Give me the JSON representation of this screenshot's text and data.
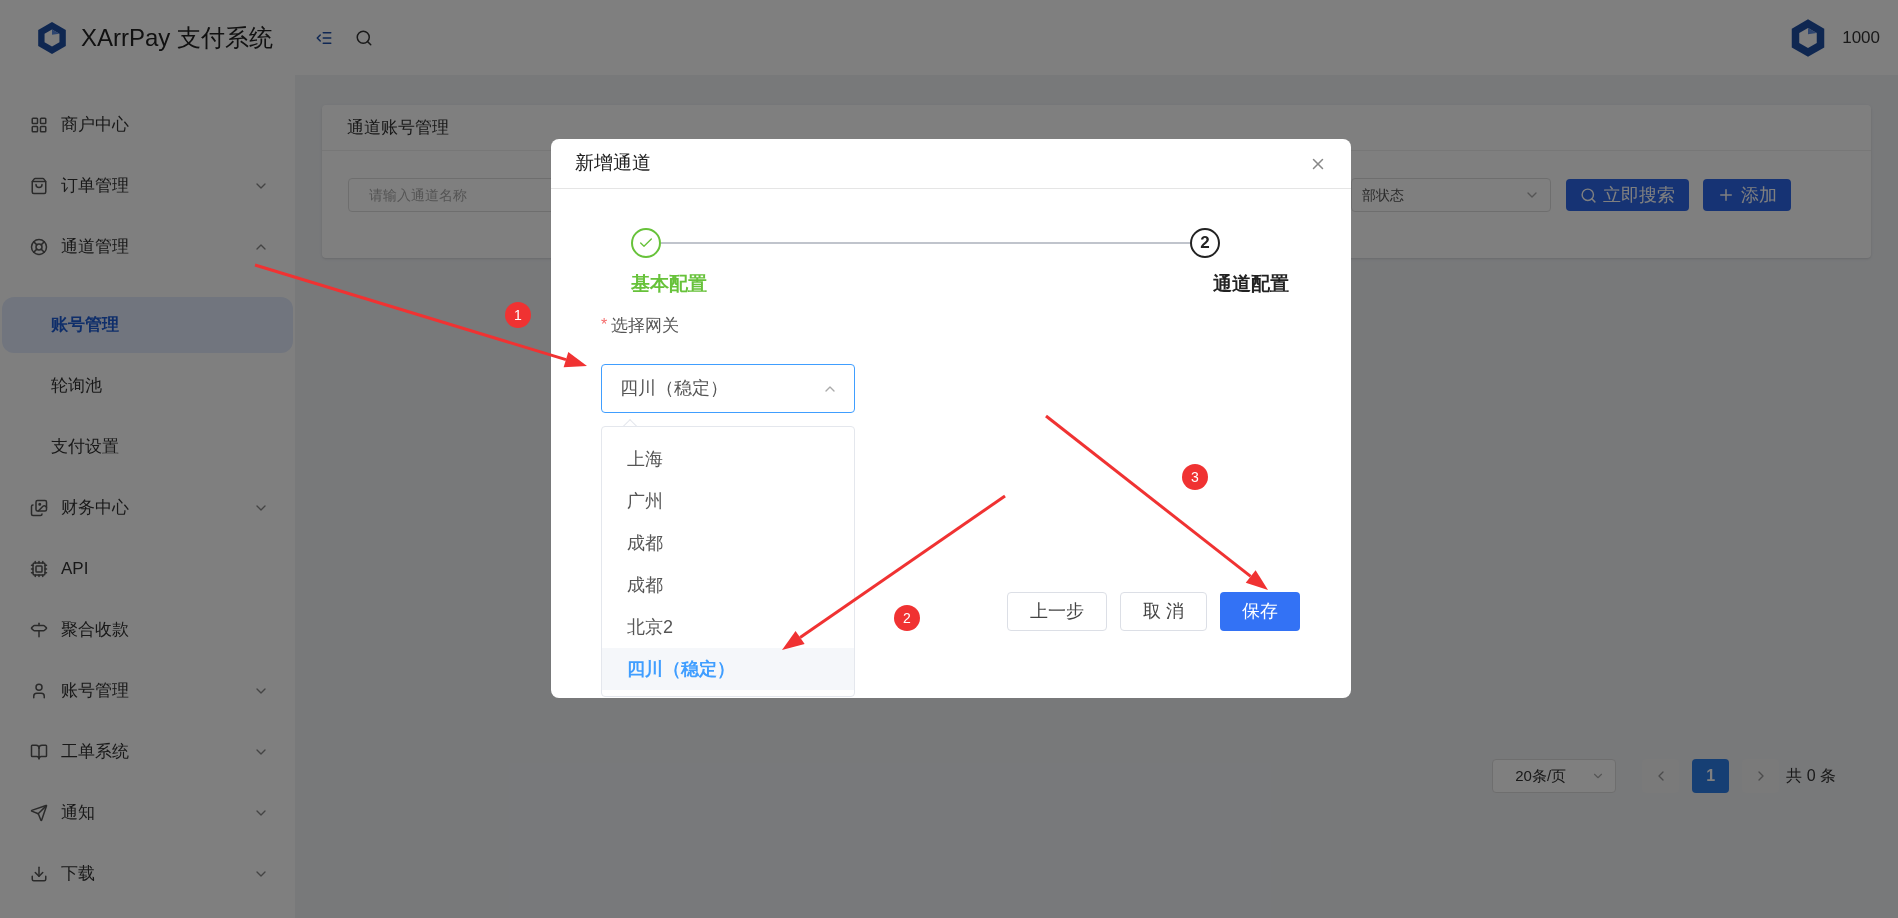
{
  "header": {
    "logo_text": "XArrPay 支付系统",
    "user": "1000"
  },
  "sidebar": {
    "items": [
      {
        "label": "商户中心",
        "kind": "link"
      },
      {
        "label": "订单管理",
        "kind": "menu",
        "expanded": false
      },
      {
        "label": "通道管理",
        "kind": "menu",
        "expanded": true,
        "children": [
          {
            "label": "账号管理",
            "selected": true
          },
          {
            "label": "轮询池",
            "selected": false
          },
          {
            "label": "支付设置",
            "selected": false
          }
        ]
      },
      {
        "label": "财务中心",
        "kind": "menu",
        "expanded": false
      },
      {
        "label": "API",
        "kind": "link"
      },
      {
        "label": "聚合收款",
        "kind": "link"
      },
      {
        "label": "账号管理",
        "kind": "menu",
        "expanded": false
      },
      {
        "label": "工单系统",
        "kind": "menu",
        "expanded": false
      },
      {
        "label": "通知",
        "kind": "menu",
        "expanded": false
      },
      {
        "label": "下载",
        "kind": "menu",
        "expanded": false
      }
    ]
  },
  "content": {
    "card_title": "通道账号管理",
    "search": {
      "placeholder": "请输入通道名称"
    },
    "status_select": {
      "value": "部状态"
    },
    "buttons": [
      {
        "label": "立即搜索",
        "kind": "search"
      },
      {
        "label": "添加",
        "kind": "add"
      }
    ],
    "pagination": {
      "page_size": "20条/页",
      "pages": [
        {
          "label": "1",
          "selected": true
        }
      ],
      "total": "共 0 条"
    }
  },
  "modal": {
    "title": "新增通道",
    "steps": [
      {
        "label": "基本配置",
        "completed": true
      },
      {
        "label": "通道配置",
        "completed": false,
        "number": "2"
      }
    ],
    "field": {
      "label": "选择网关",
      "required_mark": "*",
      "value": "四川（稳定）",
      "expanded": true
    },
    "options": [
      {
        "label": "上海",
        "selected": false
      },
      {
        "label": "广州",
        "selected": false
      },
      {
        "label": "成都",
        "selected": false
      },
      {
        "label": "成都",
        "selected": false
      },
      {
        "label": "北京2",
        "selected": false
      },
      {
        "label": "四川（稳定）",
        "selected": true
      }
    ],
    "buttons": [
      {
        "label": "上一步",
        "kind": "default"
      },
      {
        "label": "取 消",
        "kind": "default"
      },
      {
        "label": "保存",
        "kind": "primary"
      }
    ]
  },
  "annotations": [
    {
      "number": "1"
    },
    {
      "number": "2"
    },
    {
      "number": "3"
    }
  ]
}
